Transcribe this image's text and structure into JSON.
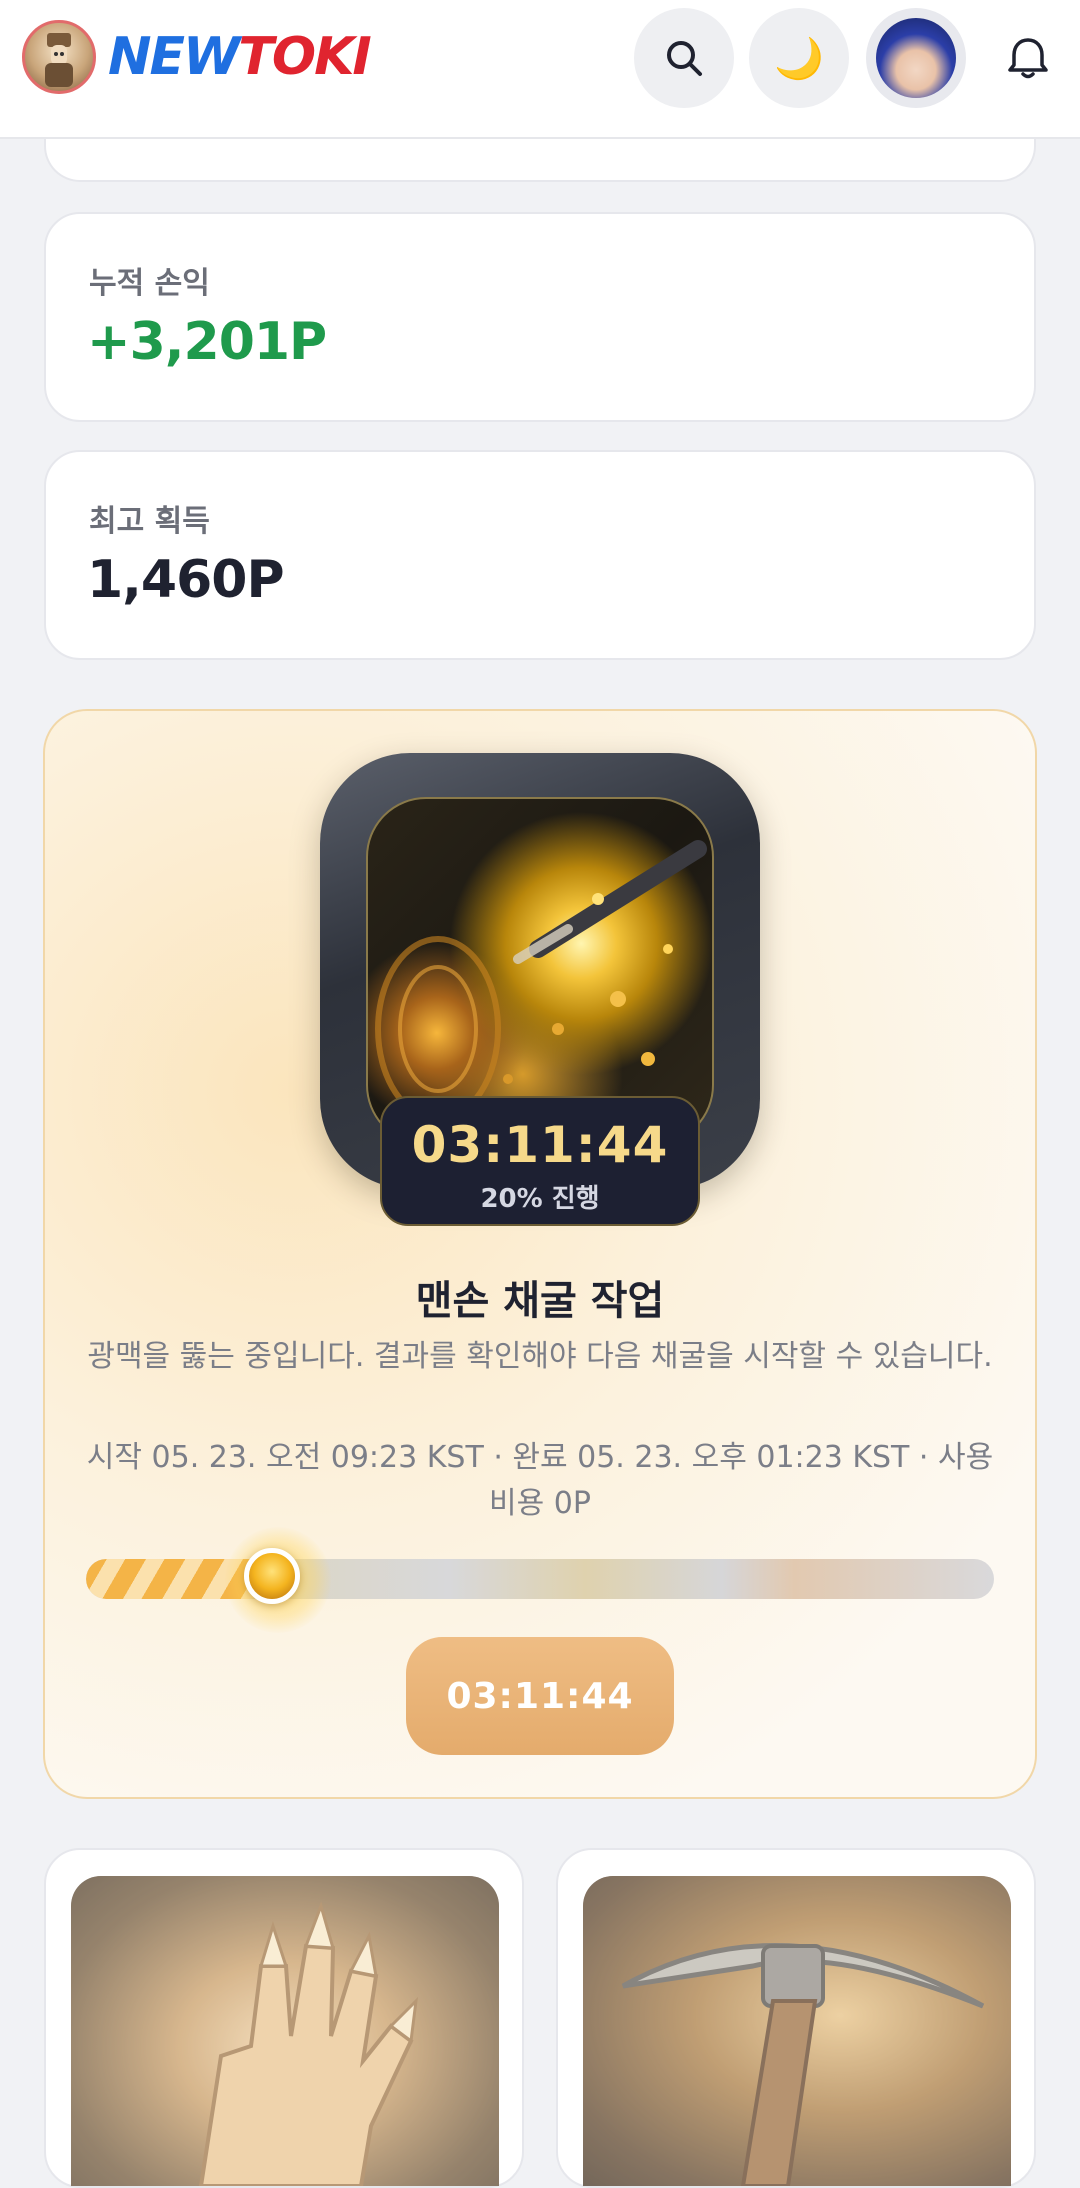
{
  "header": {
    "logo_new": "NEW",
    "logo_toki": "TOKI",
    "theme_icon": "🌙"
  },
  "stats": {
    "profit_label": "누적 손익",
    "profit_value": "+3,201P",
    "best_label": "최고 획득",
    "best_value": "1,460P"
  },
  "mining": {
    "timer": "03:11:44",
    "progress_text": "20% 진행",
    "progress": 0.2,
    "title": "맨손 채굴 작업",
    "description": "광맥을 뚫는 중입니다. 결과를 확인해야 다음 채굴을 시작할 수 있습니다.",
    "meta": "시작 05. 23. 오전 09:23 KST · 완료 05. 23. 오후 01:23 KST · 사용 비용 0P",
    "button_label": "03:11:44"
  },
  "colors": {
    "positive": "#1f9a4c",
    "accent_gold": "#f6d98a",
    "button": "#e4ab6c"
  }
}
